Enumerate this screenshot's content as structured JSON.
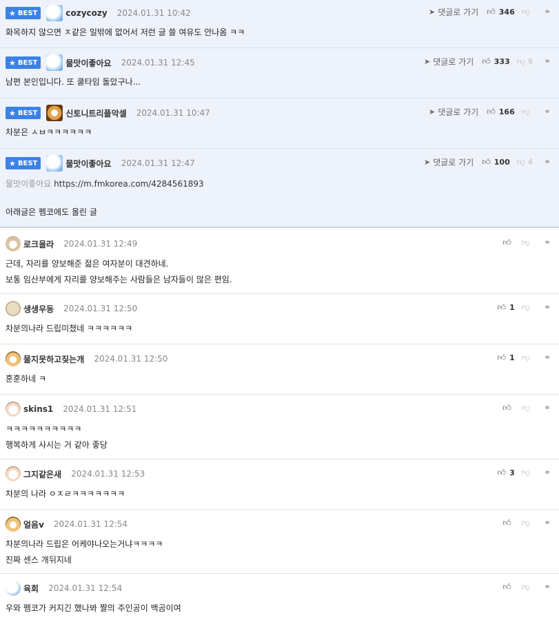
{
  "best_badge": "BEST",
  "reply_label": "댓글로 가기",
  "comments": [
    {
      "best": true,
      "avatar": "polar-bear-avatar",
      "nick": "cozycozy",
      "date": "2024.01.31 10:42",
      "up": "346",
      "down": "",
      "lines": [
        "화목하지 않으면 ㅈ같은 일밖에 없어서 저런 글 쓸 여유도 안나옴 ㅋㅋ"
      ]
    },
    {
      "best": true,
      "avatar": "polar-bear-avatar",
      "nick": "물맛이좋아요",
      "date": "2024.01.31 12:45",
      "up": "333",
      "down": "9",
      "lines": [
        "남편 본인입니다. 또 쿨타임 돌았구나..."
      ]
    },
    {
      "best": true,
      "avatar": "fox-avatar",
      "nick": "신토니트리플악셀",
      "date": "2024.01.31 10:47",
      "up": "166",
      "down": "",
      "lines": [
        "차분은 ㅅㅂㅋㅋㅋㅋㅋㅋ"
      ]
    },
    {
      "best": true,
      "avatar": "polar-bear-avatar",
      "nick": "물맛이좋아요",
      "date": "2024.01.31 12:47",
      "up": "100",
      "down": "4",
      "ref_nick": "물맛이좋아요",
      "ref_url": "https://m.fmkorea.com/4284561893",
      "lines": [
        "아래글은 펨코에도 올린 글"
      ]
    },
    {
      "best": false,
      "avatar": "dog-avatar",
      "nick": "로크올라",
      "date": "2024.01.31 12:49",
      "up": "",
      "lines": [
        "근데, 자리를 양보해준 젊은 여자분이 대견하네.",
        "보통 임산부에게 자리를 양보해주는 사람들은 남자들이 많은 편임."
      ]
    },
    {
      "best": false,
      "avatar": "round-avatar",
      "nick": "생생우동",
      "date": "2024.01.31 12:50",
      "up": "1",
      "lines": [
        "차분의나라 드립미쳤네 ㅋㅋㅋㅋㅋㅋ"
      ]
    },
    {
      "best": false,
      "avatar": "chihuahua-avatar",
      "nick": "물지못하고짖는개",
      "date": "2024.01.31 12:50",
      "up": "1",
      "lines": [
        "훈훈하네 ㅋ"
      ]
    },
    {
      "best": false,
      "avatar": "puppy-avatar",
      "nick": "skins1",
      "date": "2024.01.31 12:51",
      "up": "",
      "lines": [
        "ㅋㅋㅋㅋㅋㅋㅋㅋㅋㅋ",
        "행복하게 사시는 거 같아 좋당"
      ]
    },
    {
      "best": false,
      "avatar": "puppy-avatar",
      "nick": "그지같은새",
      "date": "2024.01.31 12:53",
      "up": "3",
      "lines": [
        "차분의 나라 ㅇㅈㄹㅋㅋㅋㅋㅋㅋㅋ"
      ]
    },
    {
      "best": false,
      "avatar": "chihuahua-avatar",
      "nick": "얼음v",
      "date": "2024.01.31 12:54",
      "up": "",
      "lines": [
        "차분의나라 드립은 어케야나오는거냐ㅋㅋㅋㅋ",
        "진짜 센스 개뒤지네"
      ]
    },
    {
      "best": false,
      "avatar": "polar-bear-avatar",
      "nick": "육회",
      "date": "2024.01.31 12:54",
      "up": "",
      "lines": [
        "우와 펨코가 커지긴 했나봐 짤의 주인공이 백곰이여"
      ]
    }
  ]
}
